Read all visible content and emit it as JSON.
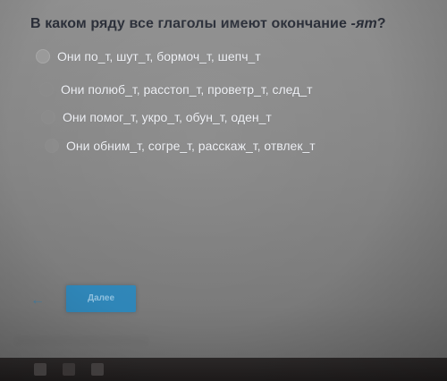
{
  "question": {
    "prefix": "В каком ряду все глаголы имеют окончание ",
    "ending": "-ят",
    "suffix": "?"
  },
  "options": [
    {
      "label": "Они по_т, шут_т, бормоч_т, шепч_т"
    },
    {
      "label": "Они полюб_т, расстоп_т, проветр_т, след_т"
    },
    {
      "label": "Они помог_т, укро_т, обун_т, оден_т"
    },
    {
      "label": "Они обним_т, согре_т, расскаж_т, отвлек_т"
    }
  ],
  "navigation": {
    "back_icon": "←",
    "next_label": "Далее"
  },
  "colors": {
    "accent": "#2f86b8",
    "question_text": "#2a2e38",
    "option_text": "#eef0f4"
  }
}
